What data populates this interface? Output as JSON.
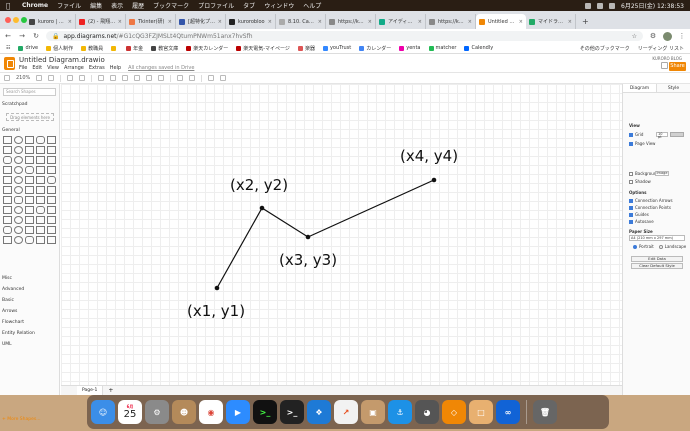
{
  "menubar": {
    "app": "Chrome",
    "items": [
      "ファイル",
      "編集",
      "表示",
      "履歴",
      "ブックマーク",
      "プロファイル",
      "タブ",
      "ウィンドウ",
      "ヘルプ"
    ],
    "clock": "6月25日(金)  12:38:53"
  },
  "tabs": [
    {
      "title": "kuroro | Tro",
      "color": "#444"
    },
    {
      "title": "(2) - 飛翔特訓",
      "color": "#e22"
    },
    {
      "title": "Tkinter(研)",
      "color": "#e74"
    },
    {
      "title": "[超特化プロ]",
      "color": "#35a"
    },
    {
      "title": "kurorobloo",
      "color": "#222"
    },
    {
      "title": "8.10. Canvas",
      "color": "#aaa"
    },
    {
      "title": "https://kuro",
      "color": "#888"
    },
    {
      "title": "アイディア出",
      "color": "#1a8"
    },
    {
      "title": "https://kuro",
      "color": "#888"
    },
    {
      "title": "Untitled Diag",
      "color": "#f08705"
    },
    {
      "title": "マイドライブ",
      "color": "#2a6"
    }
  ],
  "new_tab": "+",
  "address": {
    "host": "app.diagrams.net",
    "path": "/#G1cQG3FZJMSLt4QtumPNWm51anx7hvSfh"
  },
  "bookmarks": [
    {
      "label": "drive",
      "color": "#2a6"
    },
    {
      "label": "個人制作",
      "color": "#f2b705"
    },
    {
      "label": "教職員",
      "color": "#f2b705"
    },
    {
      "label": "",
      "color": "#f2b705"
    },
    {
      "label": "年金",
      "color": "#c33"
    },
    {
      "label": "教官文庫",
      "color": "#444"
    },
    {
      "label": "楽天カレンダー",
      "color": "#b00"
    },
    {
      "label": "楽天電気-マイページ",
      "color": "#b00"
    },
    {
      "label": "楽器",
      "color": "#d55"
    },
    {
      "label": "youTrust",
      "color": "#38f"
    },
    {
      "label": "カレンダー",
      "color": "#4285f4"
    },
    {
      "label": "yenta",
      "color": "#e0a"
    },
    {
      "label": "matcher",
      "color": "#2b5"
    },
    {
      "label": "Calendly",
      "color": "#06f"
    }
  ],
  "bookmarks_right": [
    "その他のブックマーク",
    "リーディング リスト"
  ],
  "drawio": {
    "doc_title": "Untitled Diagram.drawio",
    "menu": [
      "File",
      "Edit",
      "View",
      "Arrange",
      "Extras",
      "Help"
    ],
    "unsaved": "All changes saved in Drive",
    "account": "KURORO BLOG",
    "share": "Share",
    "zoom": "210%",
    "search_placeholder": "Search Shapes",
    "scratchpad": "Scratchpad",
    "scratch_drop": "Drag elements here",
    "sections": [
      "General",
      "Misc",
      "Advanced",
      "Basic",
      "Arrows",
      "Flowchart",
      "Entity Relation",
      "UML"
    ],
    "more_shapes": "+ More Shapes...",
    "page_tab": "Page-1",
    "add_page": "+",
    "format_tabs": [
      "Diagram",
      "Style"
    ],
    "view_heading": "View",
    "grid": "Grid",
    "grid_size": "10 pt",
    "page_view": "Page View",
    "background": "Background",
    "image_btn": "Image",
    "shadow": "Shadow",
    "options_heading": "Options",
    "connection_arrows": "Connection Arrows",
    "connection_points": "Connection Points",
    "guides": "Guides",
    "autosave": "Autosave",
    "paper_size_heading": "Paper Size",
    "paper_size": "A4 (210 mm x 297 mm)",
    "portrait": "Portrait",
    "landscape": "Landscape",
    "edit_data": "Edit Data",
    "clear_default_style": "Clear Default Style"
  },
  "diagram": {
    "points": [
      {
        "label": "(x1, y1)"
      },
      {
        "label": "(x2, y2)"
      },
      {
        "label": "(x3, y3)"
      },
      {
        "label": "(x4, y4)"
      }
    ]
  },
  "dock": {
    "calendar_month": "6月",
    "calendar_day": "25"
  }
}
